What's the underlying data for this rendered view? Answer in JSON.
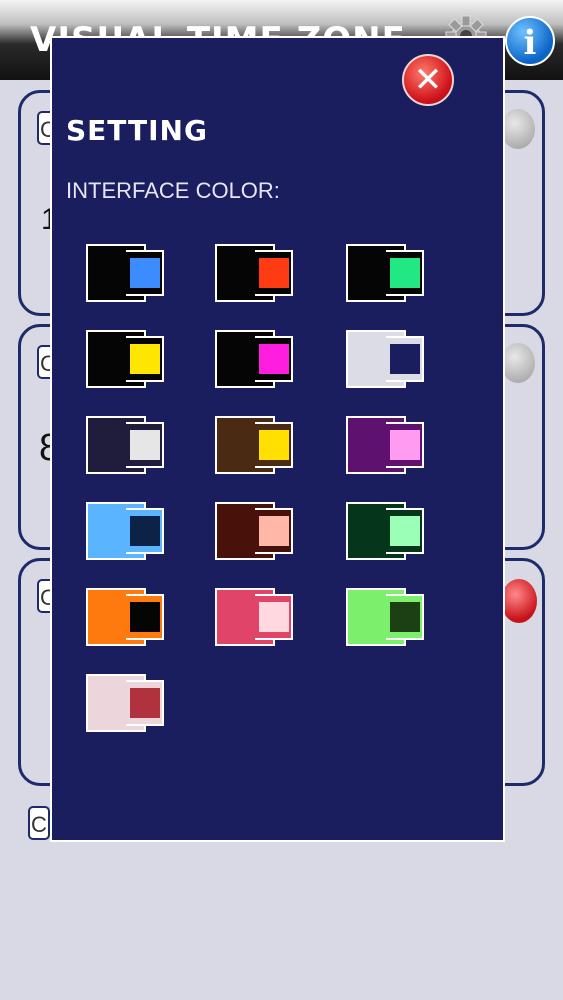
{
  "app": {
    "title": "VISUAL TIME ZONE"
  },
  "background": {
    "cards": [
      {
        "button_label": "C"
      },
      {
        "button_label": "C"
      },
      {
        "button_label": "C"
      }
    ],
    "extra_button_label": "C",
    "partial_glyphs": [
      "1",
      "8"
    ]
  },
  "dialog": {
    "title": "SETTING",
    "label": "INTERFACE COLOR:",
    "close_symbol": "✕",
    "swatches": [
      {
        "name": "black-blue",
        "outer": "#050505",
        "inner": "#3c8cff"
      },
      {
        "name": "black-red",
        "outer": "#050505",
        "inner": "#ff3b14"
      },
      {
        "name": "black-green",
        "outer": "#050505",
        "inner": "#22e884"
      },
      {
        "name": "black-yellow",
        "outer": "#050505",
        "inner": "#ffe600"
      },
      {
        "name": "black-magenta",
        "outer": "#050505",
        "inner": "#ff1ee0"
      },
      {
        "name": "white-navy",
        "outer": "#dcdce6",
        "inner": "#1a1e5e"
      },
      {
        "name": "darknavy-white",
        "outer": "#1f1c3c",
        "inner": "#e6e6e6"
      },
      {
        "name": "brown-yellow",
        "outer": "#4a2a12",
        "inner": "#ffe000"
      },
      {
        "name": "purple-pink",
        "outer": "#5e116e",
        "inner": "#ff9cf2"
      },
      {
        "name": "skyblue-navy",
        "outer": "#5ab4ff",
        "inner": "#0c2246"
      },
      {
        "name": "maroon-peach",
        "outer": "#48120a",
        "inner": "#ffb8a8"
      },
      {
        "name": "darkgreen-mint",
        "outer": "#05361c",
        "inner": "#9cffb8"
      },
      {
        "name": "orange-black",
        "outer": "#ff7a0e",
        "inner": "#050505"
      },
      {
        "name": "rose-lightpink",
        "outer": "#e04468",
        "inner": "#ffd8e0"
      },
      {
        "name": "lightgreen-darkgreen",
        "outer": "#7cf06c",
        "inner": "#1c4014"
      },
      {
        "name": "palepink-crimson",
        "outer": "#ecd6dc",
        "inner": "#b0323c"
      }
    ]
  }
}
